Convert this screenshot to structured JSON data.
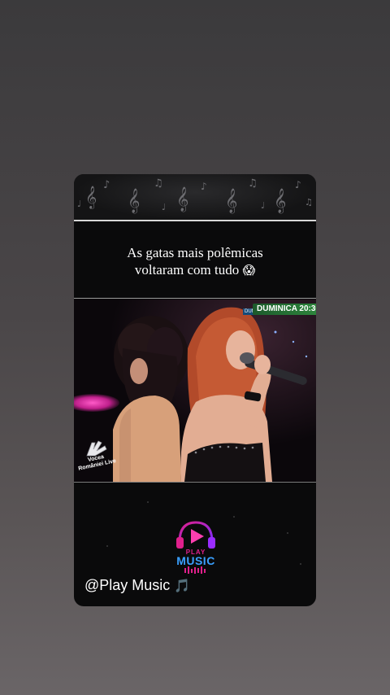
{
  "story": {
    "caption_line1": "As gatas mais polêmicas",
    "caption_line2": "voltaram com tudo",
    "caption_emoji": "😱",
    "handle_text": "@Play Music",
    "handle_emoji": "🎵"
  },
  "video": {
    "channel_badge": "DUMINICA 20:30",
    "channel_small": "DUM",
    "show_logo_text": "Vocea României Live"
  },
  "brand_logo": {
    "line1": "PLAY",
    "line2": "MUSIC"
  },
  "colors": {
    "background_top": "#3b3a3c",
    "card": "#0a0a0b",
    "accent_pink": "#e0208c",
    "accent_blue": "#2a8cff",
    "badge_green": "#2f8a3e"
  },
  "icons": [
    "treble-clef-icon",
    "music-note-icon",
    "voice-hand-logo",
    "headphones-play-icon"
  ]
}
